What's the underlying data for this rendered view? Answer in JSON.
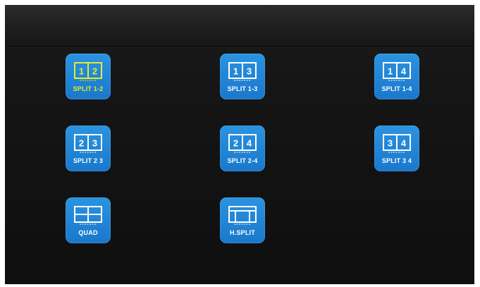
{
  "colors": {
    "tile": "#1d7fd2",
    "selected_accent": "#e8ea2e",
    "icon_stroke": "#ffffff",
    "background": "#141414"
  },
  "layouts": [
    {
      "label": "SPLIT 1-2",
      "icon": "split-1-2-icon",
      "digits": [
        "1",
        "2"
      ],
      "selected": true
    },
    {
      "label": "SPLIT 1-3",
      "icon": "split-1-3-icon",
      "digits": [
        "1",
        "3"
      ],
      "selected": false
    },
    {
      "label": "SPLIT 1-4",
      "icon": "split-1-4-icon",
      "digits": [
        "1",
        "4"
      ],
      "selected": false
    },
    {
      "label": "SPLIT 2 3",
      "icon": "split-2-3-icon",
      "digits": [
        "2",
        "3"
      ],
      "selected": false
    },
    {
      "label": "SPLIT 2-4",
      "icon": "split-2-4-icon",
      "digits": [
        "2",
        "4"
      ],
      "selected": false
    },
    {
      "label": "SPLIT 3 4",
      "icon": "split-3-4-icon",
      "digits": [
        "3",
        "4"
      ],
      "selected": false
    },
    {
      "label": "QUAD",
      "icon": "quad-icon",
      "digits": [],
      "selected": false
    },
    {
      "label": "H.SPLIT",
      "icon": "h-split-icon",
      "digits": [],
      "selected": false
    }
  ]
}
